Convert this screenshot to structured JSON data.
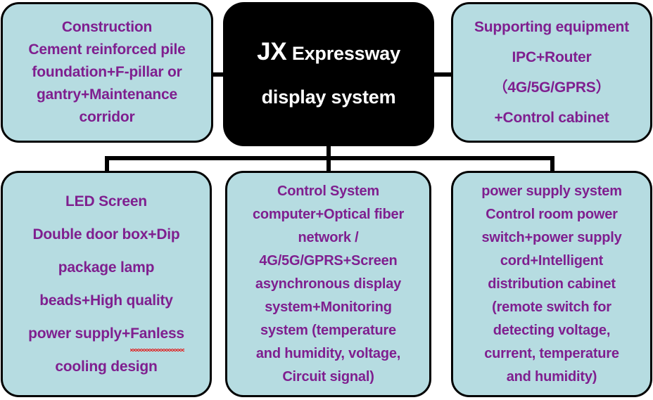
{
  "colors": {
    "box_fill": "#b6dce1",
    "box_border": "#000000",
    "text_purple": "#7f1f8f",
    "root_fill": "#000000",
    "root_text": "#ffffff",
    "spellcheck_underline": "#e02020",
    "background": "#ffffff"
  },
  "root": {
    "title_prefix": "JX",
    "title_rest": "Expressway",
    "title_line2": "display system"
  },
  "nodes": {
    "construction": {
      "lines": [
        "Construction",
        "Cement reinforced pile",
        "foundation+F-pillar or",
        "gantry+Maintenance",
        "corridor"
      ]
    },
    "supporting": {
      "lines": [
        "Supporting equipment",
        "IPC+Router",
        "（4G/5G/GPRS）",
        "+Control cabinet"
      ]
    },
    "led": {
      "lines": [
        "LED Screen",
        "Double door box+Dip",
        "package lamp",
        "beads+High quality",
        "cooling design"
      ],
      "line_with_squiggle": {
        "prefix": "power supply+",
        "misspelled": "Fanless"
      }
    },
    "control": {
      "lines": [
        "Control System",
        "computer+Optical fiber",
        "network /",
        "4G/5G/GPRS+Screen",
        "asynchronous display",
        "system+Monitoring",
        "system (temperature",
        "and humidity, voltage,",
        "Circuit signal)"
      ]
    },
    "power": {
      "lines": [
        "power supply system",
        "Control room power",
        "switch+power supply",
        "cord+Intelligent",
        "distribution cabinet",
        "(remote switch for",
        "detecting voltage,",
        "current, temperature",
        "and humidity)"
      ]
    }
  }
}
